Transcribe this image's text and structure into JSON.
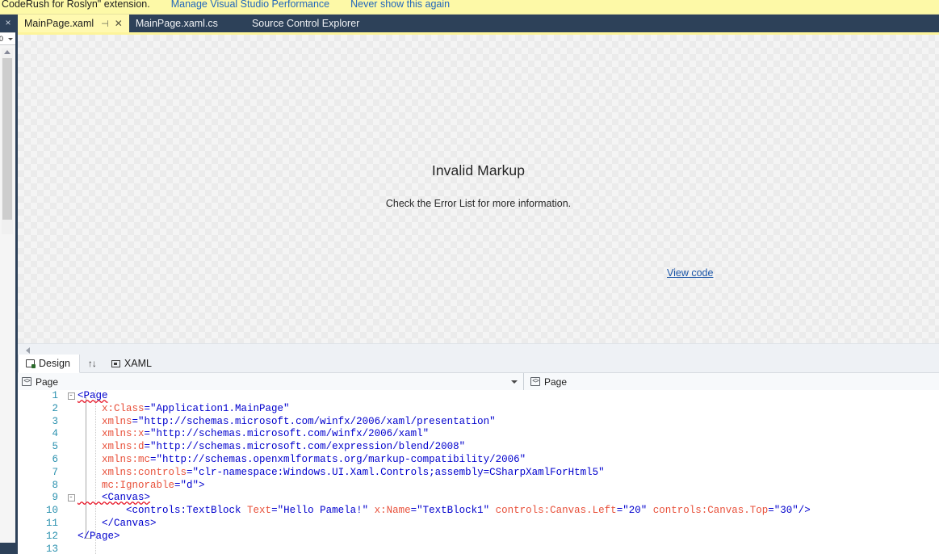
{
  "notification": {
    "text": "CodeRush for Roslyn\" extension.",
    "link_performance": "Manage Visual Studio Performance",
    "link_dismiss": "Never show this again",
    "bg_color": "#fdf9a7",
    "link_color": "#2266bb"
  },
  "left_rail": {
    "close_icon_label": "×",
    "zoom_value": "0",
    "scrollbar_name": "vertical-scrollbar"
  },
  "tabs": [
    {
      "label": "MainPage.xaml",
      "active": true,
      "pin_glyph": "⊣",
      "close_glyph": "✕"
    },
    {
      "label": "MainPage.xaml.cs",
      "active": false
    },
    {
      "label": "Source Control Explorer",
      "active": false
    }
  ],
  "designer": {
    "title": "Invalid Markup",
    "subtitle": "Check the Error List for more information.",
    "view_code_link": "View code",
    "link_color": "#1b56a8",
    "surface_bg": "#f4f4f4",
    "checker_color": "#ebebeb",
    "top_accent": "#fdf49a"
  },
  "design_tabs": {
    "design_label": "Design",
    "swap_glyph": "↑↓",
    "xaml_label": "XAML",
    "active": "Design"
  },
  "breadcrumb": {
    "left_label": "Page",
    "right_label": "Page",
    "caret_glyph": "▾"
  },
  "code": {
    "language": "XAML",
    "lines": [
      {
        "n": "1",
        "fold": "-",
        "indent": 0,
        "tokens": [
          {
            "t": "<Page",
            "c": "tg squig"
          }
        ]
      },
      {
        "n": "2",
        "fold": "",
        "indent": 0,
        "tokens": [
          {
            "t": "    x:Class",
            "c": "at"
          },
          {
            "t": "=",
            "c": "eq"
          },
          {
            "t": "\"Application1.MainPage\"",
            "c": "vl"
          }
        ]
      },
      {
        "n": "3",
        "fold": "",
        "indent": 0,
        "tokens": [
          {
            "t": "    xmlns",
            "c": "at"
          },
          {
            "t": "=",
            "c": "eq"
          },
          {
            "t": "\"http://schemas.microsoft.com/winfx/2006/xaml/presentation\"",
            "c": "vl"
          }
        ]
      },
      {
        "n": "4",
        "fold": "",
        "indent": 0,
        "tokens": [
          {
            "t": "    xmlns:x",
            "c": "at"
          },
          {
            "t": "=",
            "c": "eq"
          },
          {
            "t": "\"http://schemas.microsoft.com/winfx/2006/xaml\"",
            "c": "vl"
          }
        ]
      },
      {
        "n": "5",
        "fold": "",
        "indent": 0,
        "tokens": [
          {
            "t": "    xmlns:d",
            "c": "at"
          },
          {
            "t": "=",
            "c": "eq"
          },
          {
            "t": "\"http://schemas.microsoft.com/expression/blend/2008\"",
            "c": "vl"
          }
        ]
      },
      {
        "n": "6",
        "fold": "",
        "indent": 0,
        "tokens": [
          {
            "t": "    xmlns:mc",
            "c": "at"
          },
          {
            "t": "=",
            "c": "eq"
          },
          {
            "t": "\"http://schemas.openxmlformats.org/markup-compatibility/2006\"",
            "c": "vl"
          }
        ]
      },
      {
        "n": "7",
        "fold": "",
        "indent": 0,
        "tokens": [
          {
            "t": "    xmlns:controls",
            "c": "at"
          },
          {
            "t": "=",
            "c": "eq"
          },
          {
            "t": "\"clr-namespace:Windows.UI.Xaml.Controls;assembly=CSharpXamlForHtml5\"",
            "c": "vl"
          }
        ]
      },
      {
        "n": "8",
        "fold": "",
        "indent": 0,
        "tokens": [
          {
            "t": "    mc:Ignorable",
            "c": "at"
          },
          {
            "t": "=",
            "c": "eq"
          },
          {
            "t": "\"d\">",
            "c": "vl"
          }
        ]
      },
      {
        "n": "9",
        "fold": "-",
        "indent": 0,
        "tokens": [
          {
            "t": "    <Canvas>",
            "c": "tg squig"
          }
        ]
      },
      {
        "n": "10",
        "fold": "",
        "indent": 0,
        "tokens": [
          {
            "t": "        <controls:TextBlock ",
            "c": "tg"
          },
          {
            "t": "Text",
            "c": "at"
          },
          {
            "t": "=",
            "c": "eq"
          },
          {
            "t": "\"Hello Pamela!\"",
            "c": "vl"
          },
          {
            "t": " x:Name",
            "c": "at"
          },
          {
            "t": "=",
            "c": "eq"
          },
          {
            "t": "\"TextBlock1\"",
            "c": "vl"
          },
          {
            "t": " controls:Canvas.Left",
            "c": "at"
          },
          {
            "t": "=",
            "c": "eq"
          },
          {
            "t": "\"20\"",
            "c": "vl"
          },
          {
            "t": " controls:Canvas.Top",
            "c": "at"
          },
          {
            "t": "=",
            "c": "eq"
          },
          {
            "t": "\"30\"",
            "c": "vl"
          },
          {
            "t": "/>",
            "c": "tg"
          }
        ]
      },
      {
        "n": "11",
        "fold": "",
        "indent": 0,
        "tokens": [
          {
            "t": "    </Canvas>",
            "c": "tg"
          }
        ]
      },
      {
        "n": "12",
        "fold": "",
        "indent": 0,
        "tokens": [
          {
            "t": "</Page>",
            "c": "tg"
          }
        ]
      },
      {
        "n": "13",
        "fold": "",
        "indent": 0,
        "tokens": []
      }
    ]
  }
}
